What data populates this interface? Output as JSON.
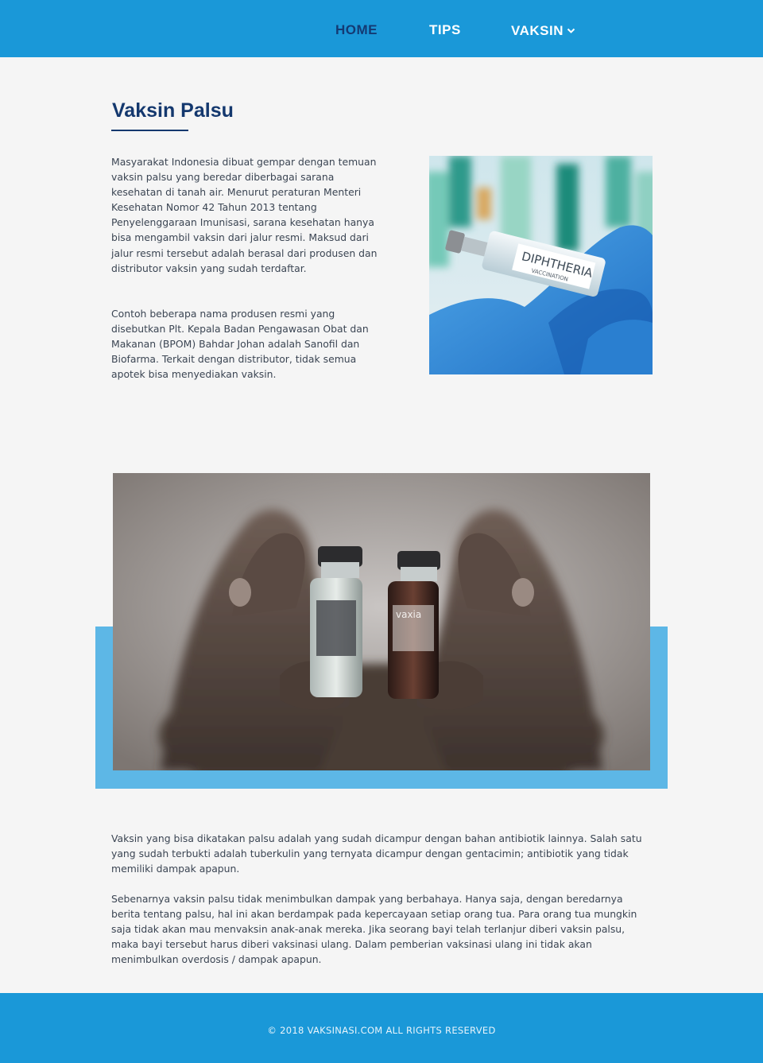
{
  "nav": {
    "items": [
      {
        "label": "HOME"
      },
      {
        "label": "TIPS"
      },
      {
        "label": "VAKSIN",
        "icon": "chevron-down-icon"
      }
    ]
  },
  "page": {
    "title": "Vaksin Palsu"
  },
  "content": {
    "p1": "Masyarakat Indonesia dibuat gempar dengan temuan vaksin palsu yang beredar diberbagai sarana kesehatan di tanah air. Menurut peraturan Menteri Kesehatan Nomor 42 Tahun 2013 tentang Penyelenggaraan Imunisasi, sarana kesehatan hanya bisa mengambil vaksin dari jalur resmi. Maksud dari jalur resmi tersebut adalah berasal dari produsen dan distributor vaksin yang sudah terdaftar.",
    "p2": "Contoh beberapa nama produsen resmi yang disebutkan Plt. Kepala Badan Pengawasan Obat dan Makanan (BPOM) Bahdar Johan adalah Sanofil dan Biofarma. Terkait dengan distributor, tidak semua apotek bisa menyediakan vaksin.",
    "p3": "Vaksin yang bisa dikatakan palsu adalah yang sudah dicampur dengan bahan antibiotik lainnya. Salah satu yang sudah terbukti adalah tuberkulin yang ternyata dicampur dengan gentacimin; antibiotik yang tidak memiliki dampak apapun.",
    "p4": "Sebenarnya vaksin palsu tidak menimbulkan dampak yang berbahaya. Hanya saja, dengan beredarnya berita tentang palsu, hal ini akan berdampak pada kepercayaan setiap orang tua. Para orang tua mungkin saja tidak akan mau menvaksin anak-anak mereka.     Jika seorang bayi telah terlanjur diberi vaksin palsu, maka bayi tersebut harus diberi vaksinasi ulang. Dalam pemberian vaksinasi ulang ini tidak akan menimbulkan overdosis / dampak apapun."
  },
  "images": {
    "vial_label": "DIPHTHERIA",
    "vial_sublabel": "VACCINATION",
    "bottle_label": "vaxia"
  },
  "footer": {
    "text": "© 2018 VAKSINASI.COM ALL RIGHTS RESERVED"
  },
  "colors": {
    "nav_bg": "#1a98d8",
    "nav_active": "#143a73",
    "title": "#14386e",
    "accent_block": "#5db7e6",
    "page_bg": "#f5f5f5"
  }
}
